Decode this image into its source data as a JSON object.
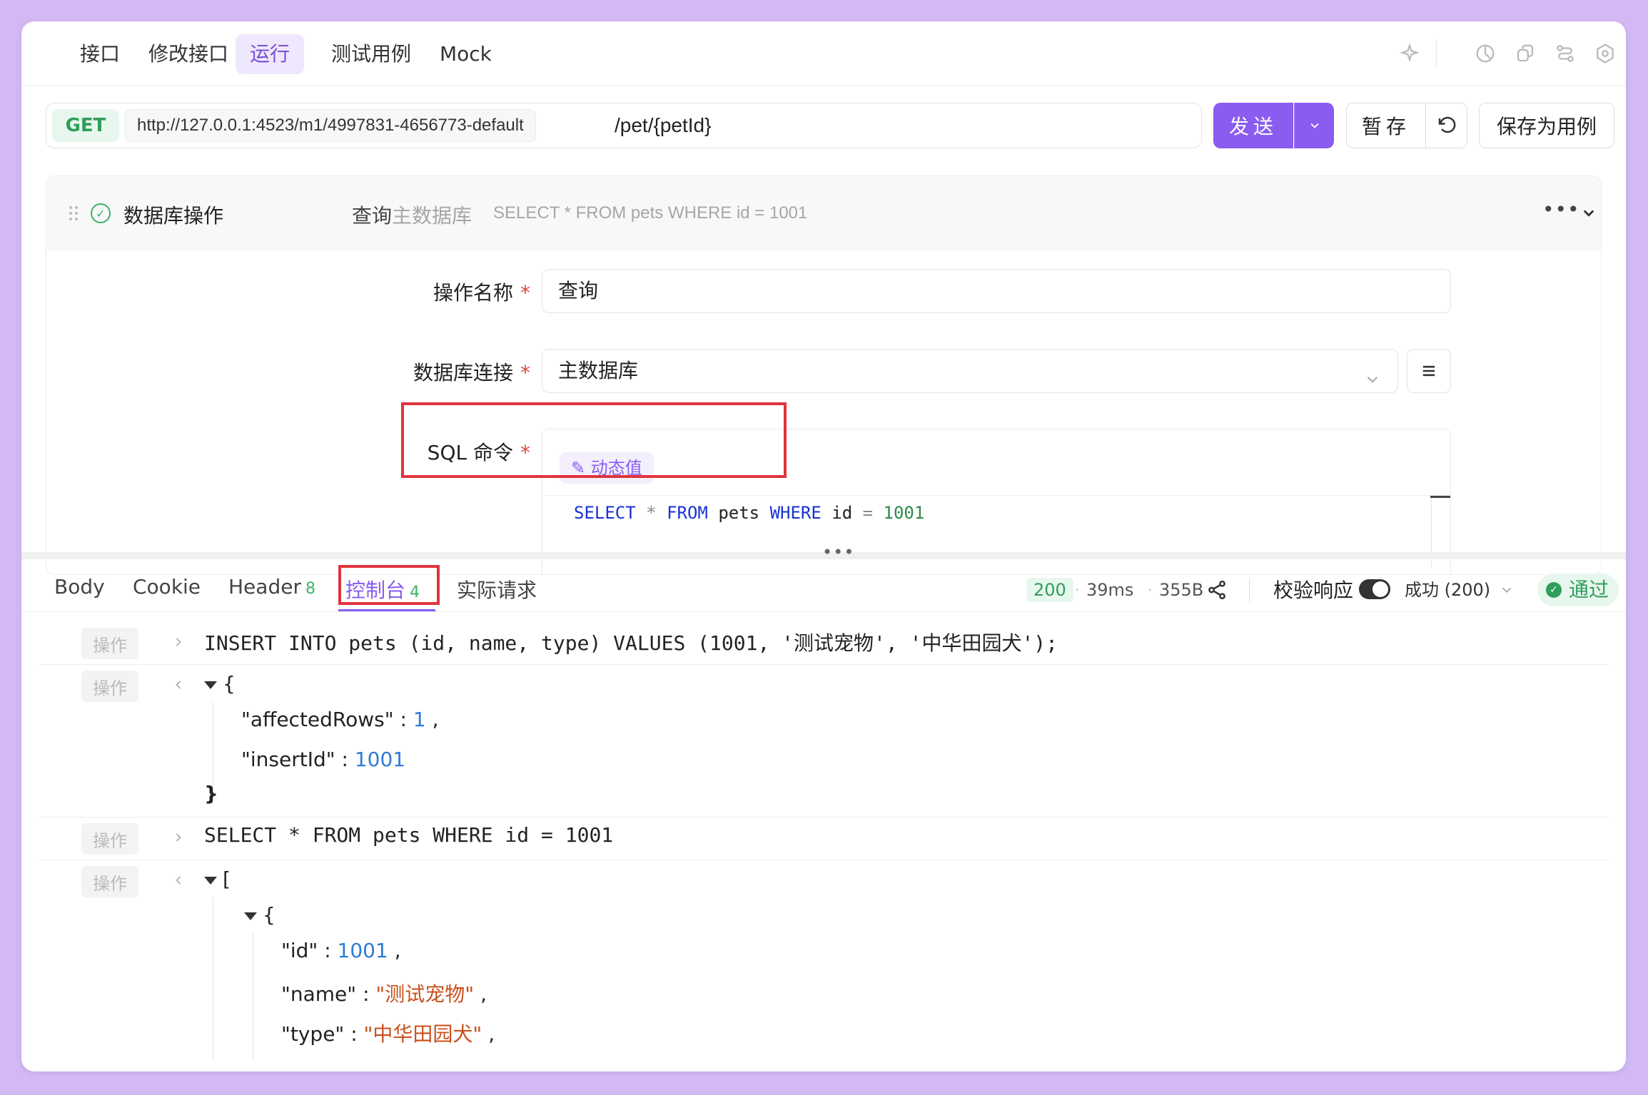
{
  "top_tabs": [
    "接口",
    "修改接口",
    "运行",
    "测试用例",
    "Mock"
  ],
  "active_tab": "运行",
  "request": {
    "method": "GET",
    "base_url": "http://127.0.0.1:4523/m1/4997831-4656773-default",
    "path": "/pet/{petId}"
  },
  "buttons": {
    "send": "发送",
    "save_temp": "暂存",
    "save_as_case": "保存为用例"
  },
  "db_operation": {
    "title": "数据库操作",
    "op_name": "查询",
    "connection": "主数据库",
    "sql_preview": "SELECT * FROM pets WHERE id = 1001",
    "form": {
      "name_label": "操作名称",
      "name_value": "查询",
      "conn_label": "数据库连接",
      "conn_value": "主数据库",
      "sql_label": "SQL 命令",
      "required_mark": "*",
      "dynamic_value_btn": "动态值",
      "sql_tokens": {
        "select": "SELECT",
        "star": "*",
        "from": "FROM",
        "table": "pets",
        "where": "WHERE",
        "col": "id",
        "eq": "=",
        "val": "1001"
      }
    }
  },
  "response_tabs": [
    {
      "label": "Body",
      "count": ""
    },
    {
      "label": "Cookie",
      "count": ""
    },
    {
      "label": "Header",
      "count": "8"
    },
    {
      "label": "控制台",
      "count": "4"
    },
    {
      "label": "实际请求",
      "count": ""
    }
  ],
  "active_response_tab": "控制台",
  "response_meta": {
    "status": "200",
    "time": "39ms",
    "size": "355B",
    "verify_label": "校验响应",
    "verify_enabled": true,
    "success_select": "成功 (200)",
    "result": "通过"
  },
  "console": {
    "op_tag": "操作",
    "line1": "INSERT INTO pets (id, name, type) VALUES (1001, '测试宠物', '中华田园犬');",
    "result1": {
      "affectedRows": 1,
      "insertId": 1001
    },
    "line2": "SELECT * FROM pets WHERE id = 1001",
    "result2_item": {
      "id": 1001,
      "name": "测试宠物",
      "type": "中华田园犬"
    },
    "json_keys": {
      "affectedRows": "\"affectedRows\"",
      "insertId": "\"insertId\"",
      "id": "\"id\"",
      "name": "\"name\"",
      "type": "\"type\""
    },
    "json_values": {
      "affectedRows": "1",
      "insertId": "1001",
      "id": "1001",
      "name": "\"测试宠物\"",
      "type": "\"中华田园犬\""
    }
  },
  "colors": {
    "accent": "#8b5cf0",
    "success": "#2f9e5a",
    "highlight_box": "#e0343d",
    "background": "#d2b9f3"
  }
}
